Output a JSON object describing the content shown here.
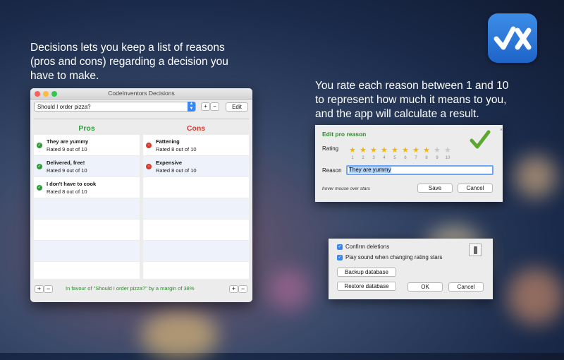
{
  "tagline_left": [
    "Decisions lets you keep a list of reasons",
    "(pros and cons) regarding a decision you",
    "have to make."
  ],
  "tagline_right": [
    "You rate each reason between 1 and 10",
    "to represent how much it means to you,",
    "and the app will calculate a result."
  ],
  "window": {
    "title": "CodeInventors Decisions",
    "decision_select": "Should I order pizza?",
    "add_label": "+",
    "remove_label": "−",
    "edit_label": "Edit",
    "pros_header": "Pros",
    "cons_header": "Cons",
    "pros": [
      {
        "title": "They are yummy",
        "rating": "Rated 9 out of 10"
      },
      {
        "title": "Delivered, free!",
        "rating": "Rated 9 out of 10"
      },
      {
        "title": "I don't have to cook",
        "rating": "Rated 8 out of 10"
      }
    ],
    "cons": [
      {
        "title": "Fattening",
        "rating": "Rated 8 out of 10"
      },
      {
        "title": "Expensive",
        "rating": "Rated 8 out of 10"
      }
    ],
    "summary": "In favour of \"Should I order pizza?\" by a margin of 38%"
  },
  "edit_dialog": {
    "header": "Edit pro reason",
    "rating_label": "Rating",
    "rating_value": 8,
    "rating_max": 10,
    "star_numbers": [
      "1",
      "2",
      "3",
      "4",
      "5",
      "6",
      "7",
      "8",
      "9",
      "10"
    ],
    "reason_label": "Reason",
    "reason_value": "They are yummy",
    "hint": "hover mouse over stars",
    "save_label": "Save",
    "cancel_label": "Cancel"
  },
  "prefs": {
    "confirm_deletions": "Confirm deletions",
    "play_sound": "Play sound when changing rating stars",
    "backup_label": "Backup database",
    "restore_label": "Restore database",
    "ok_label": "OK",
    "cancel_label": "Cancel"
  },
  "colors": {
    "pro": "#2e9a3a",
    "con": "#d43a2e",
    "accent": "#3a86f0"
  }
}
